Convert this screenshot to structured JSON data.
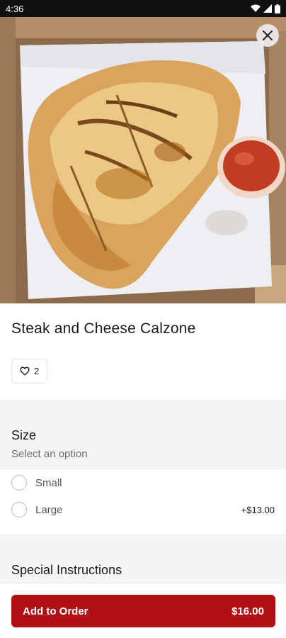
{
  "status_bar": {
    "time": "4:36"
  },
  "item": {
    "title": "Steak and Cheese Calzone",
    "likes": "2"
  },
  "size": {
    "heading": "Size",
    "subheading": "Select an option",
    "options": [
      {
        "label": "Small",
        "price": ""
      },
      {
        "label": "Large",
        "price": "+$13.00"
      }
    ]
  },
  "special": {
    "heading": "Special Instructions"
  },
  "footer": {
    "button_label": "Add to Order",
    "price": "$16.00"
  },
  "colors": {
    "accent": "#b11116",
    "background_band": "#f5f5f5"
  },
  "icons": {
    "close": "close-icon",
    "like": "heart-icon"
  }
}
